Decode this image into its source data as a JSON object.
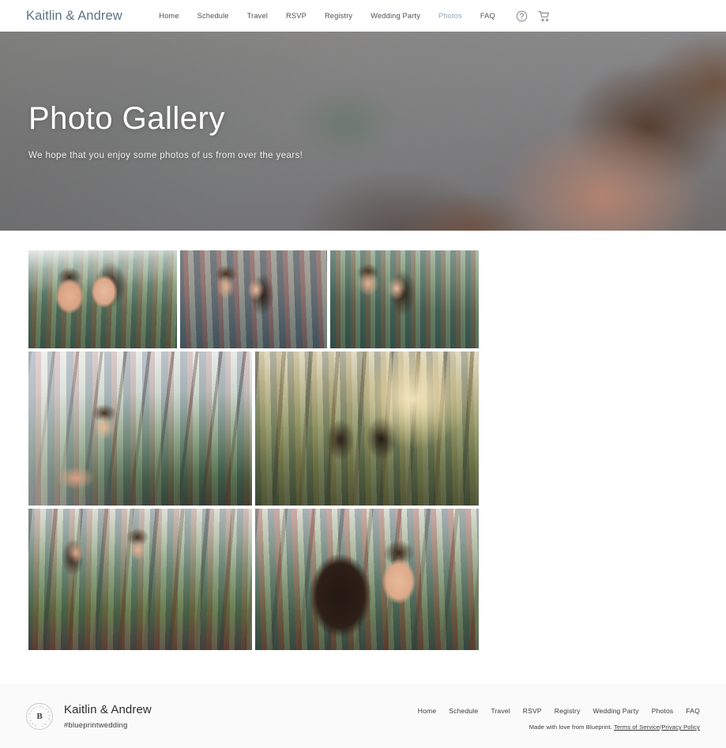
{
  "header": {
    "brand": "Kaitlin & Andrew",
    "nav": [
      {
        "label": "Home",
        "active": false
      },
      {
        "label": "Schedule",
        "active": false
      },
      {
        "label": "Travel",
        "active": false
      },
      {
        "label": "RSVP",
        "active": false
      },
      {
        "label": "Registry",
        "active": false
      },
      {
        "label": "Wedding Party",
        "active": false
      },
      {
        "label": "Photos",
        "active": true
      },
      {
        "label": "FAQ",
        "active": false
      }
    ],
    "icons": [
      {
        "name": "help-circle-icon"
      },
      {
        "name": "shopping-cart-icon"
      }
    ],
    "active_link_color": "#93a6b3",
    "brand_color": "#5d7383"
  },
  "hero": {
    "title": "Photo Gallery",
    "subtitle": "We hope that you enjoy some photos of us from over the years!",
    "image_alt": "Blurred close-up of a couple outdoors"
  },
  "gallery": {
    "photos": [
      {
        "alt": "Couple smiling, woman on man's back, forest and lake"
      },
      {
        "alt": "Couple embracing face to face beside rocky cliff"
      },
      {
        "alt": "Couple standing together, arms crossed, lake behind"
      },
      {
        "alt": "Man reaching his hand back toward camera in pine forest"
      },
      {
        "alt": "Couple seated from behind watching sunset through trees"
      },
      {
        "alt": "Couple walking and holding hands on a forest path"
      },
      {
        "alt": "Man smiling while hugging woman in the forest"
      }
    ]
  },
  "footer": {
    "names": "Kaitlin & Andrew",
    "hashtag": "#blueprintwedding",
    "logo_monogram": "B",
    "logo_ring_text": "BLUEPRINT REGISTRY",
    "nav": [
      "Home",
      "Schedule",
      "Travel",
      "RSVP",
      "Registry",
      "Wedding Party",
      "Photos",
      "FAQ"
    ],
    "credit_prefix": "Made with love from Blueprint.",
    "terms_label": "Terms of Service",
    "credit_separator": "/",
    "privacy_label": "Privacy Policy"
  }
}
